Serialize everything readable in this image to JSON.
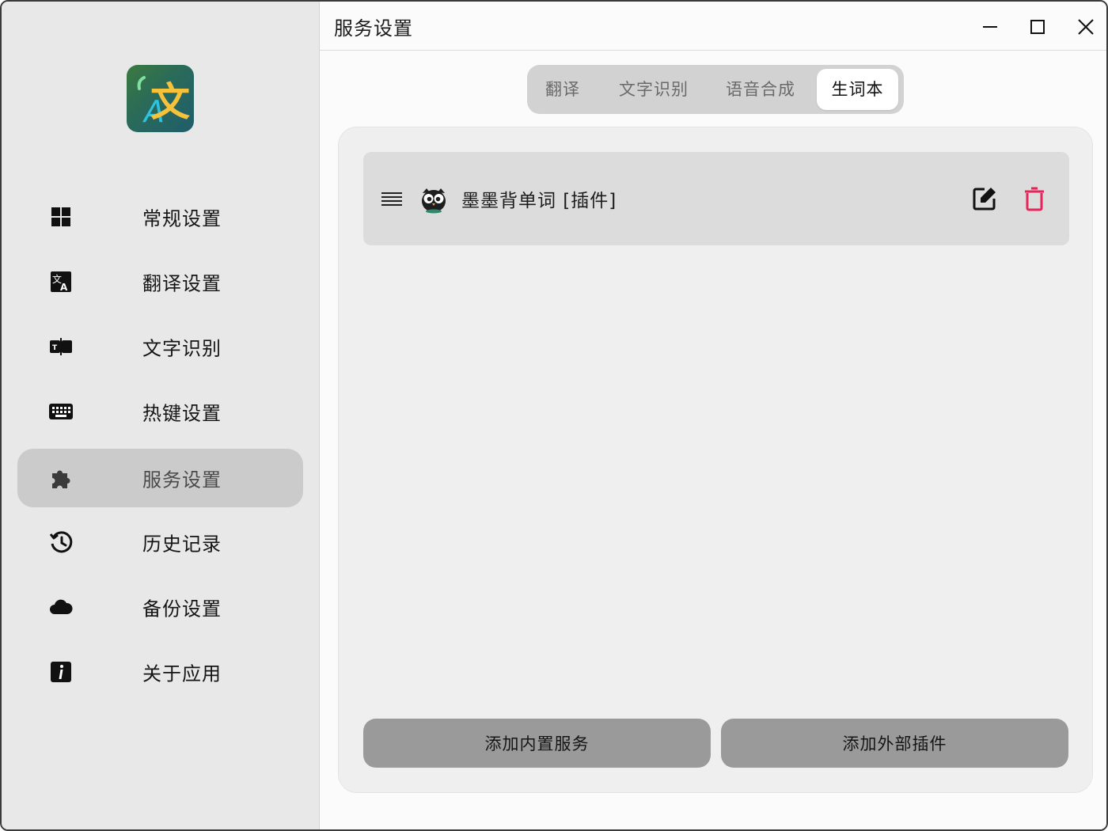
{
  "window": {
    "title": "服务设置",
    "minimize_icon": "minimize-icon",
    "maximize_icon": "maximize-icon",
    "close_icon": "close-icon"
  },
  "sidebar": {
    "items": [
      {
        "label": "常规设置",
        "icon": "grid-icon",
        "active": false
      },
      {
        "label": "翻译设置",
        "icon": "translate-icon",
        "active": false
      },
      {
        "label": "文字识别",
        "icon": "text-recognition-icon",
        "active": false
      },
      {
        "label": "热键设置",
        "icon": "keyboard-icon",
        "active": false
      },
      {
        "label": "服务设置",
        "icon": "puzzle-icon",
        "active": true
      },
      {
        "label": "历史记录",
        "icon": "history-icon",
        "active": false
      },
      {
        "label": "备份设置",
        "icon": "cloud-icon",
        "active": false
      },
      {
        "label": "关于应用",
        "icon": "info-icon",
        "active": false
      }
    ]
  },
  "tabs": [
    {
      "label": "翻译",
      "active": false
    },
    {
      "label": "文字识别",
      "active": false
    },
    {
      "label": "语音合成",
      "active": false
    },
    {
      "label": "生词本",
      "active": true
    }
  ],
  "services": [
    {
      "name": "墨墨背单词 [插件]",
      "icon": "owl-icon"
    }
  ],
  "actions": {
    "add_builtin": "添加内置服务",
    "add_external": "添加外部插件"
  },
  "colors": {
    "sidebar_bg": "#e8e8e8",
    "active_nav_bg": "#cbcbcb",
    "delete_red": "#e8245b",
    "button_gray": "#9a9a9a"
  }
}
